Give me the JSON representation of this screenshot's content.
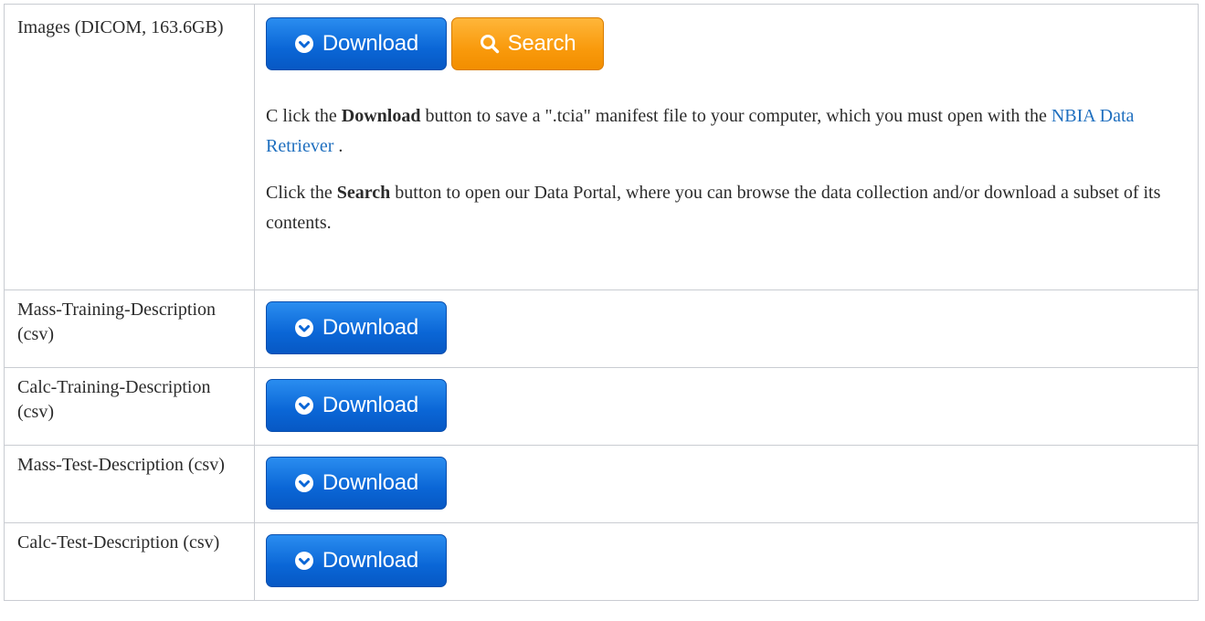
{
  "table": {
    "rows": [
      {
        "label": "Images (DICOM, 163.6GB)",
        "download_label": "Download",
        "search_label": "Search",
        "description": {
          "p1_prefix": "C lick the ",
          "p1_bold": "Download",
          "p1_middle": " button to save a \".tcia\" manifest file to your computer, which you must open with the ",
          "p1_link": "NBIA Data Retriever",
          "p1_suffix": " .",
          "p2_prefix": "Click the ",
          "p2_bold": "Search",
          "p2_suffix": " button to open our Data Portal, where you can browse the data collection and/or download a subset of its contents."
        }
      },
      {
        "label": "Mass-Training-Description (csv)",
        "download_label": "Download"
      },
      {
        "label": "Calc-Training-Description (csv)",
        "download_label": "Download"
      },
      {
        "label": "Mass-Test-Description (csv)",
        "download_label": "Download"
      },
      {
        "label": "Calc-Test-Description (csv)",
        "download_label": "Download"
      }
    ]
  },
  "icons": {
    "download": "download-circle-icon",
    "search": "search-icon"
  },
  "colors": {
    "download_button": "#0a66d6",
    "search_button": "#f99a0c",
    "link": "#1f6fbf",
    "border": "#c9ccd2"
  }
}
